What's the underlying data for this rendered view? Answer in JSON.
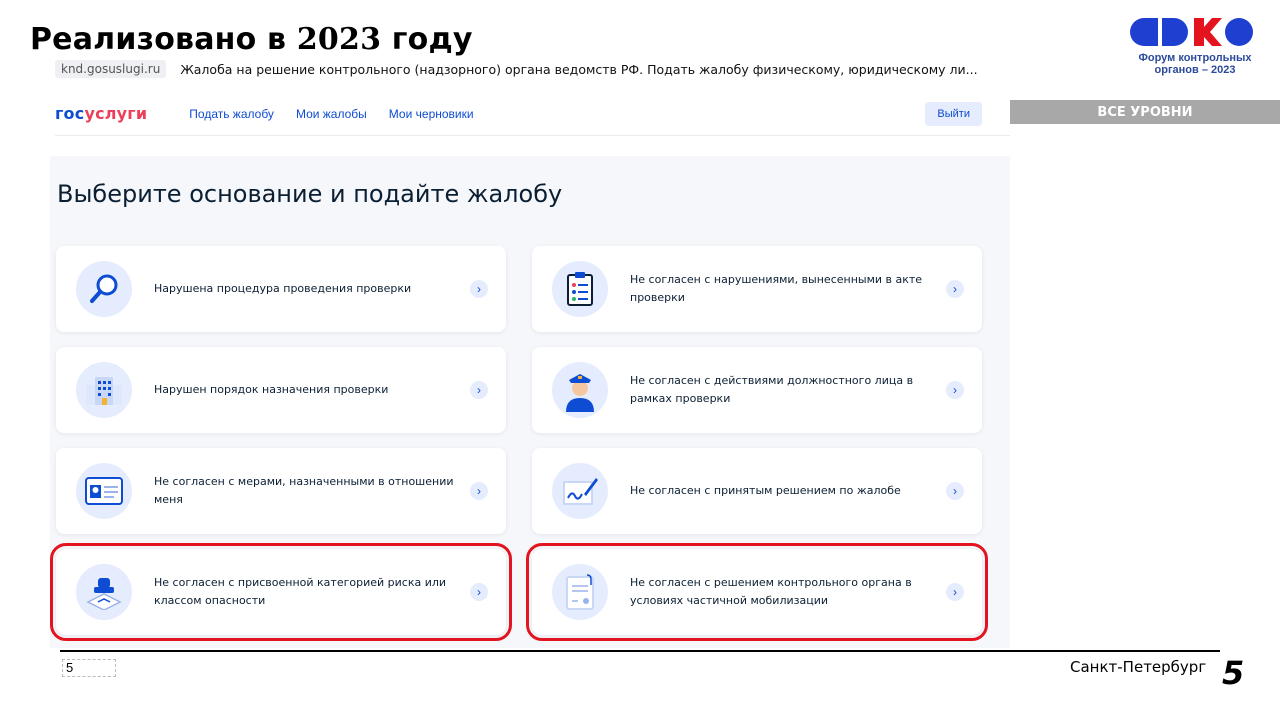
{
  "slide": {
    "title_prefix": "Реализовано в ",
    "title_year": "2023",
    "title_suffix": " году",
    "city": "Санкт-Петербург",
    "page_box": "5",
    "page_number": "5"
  },
  "logo": {
    "caption_line1": "Форум контрольных",
    "caption_line2": "органов – 2023",
    "colors": [
      "#1f3fd1",
      "#1f3fd1",
      "#e3141f",
      "#1f3fd1"
    ]
  },
  "browser": {
    "url": "knd.gosuslugi.ru",
    "page_title": "Жалоба на решение контрольного (надзорного) органа ведомств РФ. Подать жалобу физическому, юридическому ли..."
  },
  "nav": {
    "brand_part1": "гос",
    "brand_part2": "услуги",
    "links": [
      "Подать жалобу",
      "Мои жалобы",
      "Мои черновики"
    ],
    "logout_label": "Выйти"
  },
  "levels_label": "ВСЕ УРОВНИ",
  "main": {
    "title": "Выберите основание и подайте жалобу",
    "cards": [
      {
        "text": "Нарушена процедура проведения проверки",
        "icon": "magnifier-icon"
      },
      {
        "text": "Не согласен с нарушениями, вынесенными в акте проверки",
        "icon": "checklist-icon"
      },
      {
        "text": "Нарушен порядок назначения проверки",
        "icon": "building-icon"
      },
      {
        "text": "Не согласен с действиями должностного лица в рамках проверки",
        "icon": "officer-icon"
      },
      {
        "text": "Не согласен с мерами, назначенными в отношении меня",
        "icon": "id-card-icon"
      },
      {
        "text": "Не согласен с принятым решением по жалобе",
        "icon": "signature-icon"
      },
      {
        "text": "Не согласен с присвоенной категорией риска или классом опасности",
        "icon": "stamp-icon"
      },
      {
        "text": "Не согласен с решением контрольного органа в условиях частичной мобилизации",
        "icon": "document-icon"
      }
    ]
  },
  "colors": {
    "accent": "#0d4cd3",
    "brand_red": "#ee3f58",
    "highlight": "#e3141f",
    "panel": "#f5f7fb"
  }
}
